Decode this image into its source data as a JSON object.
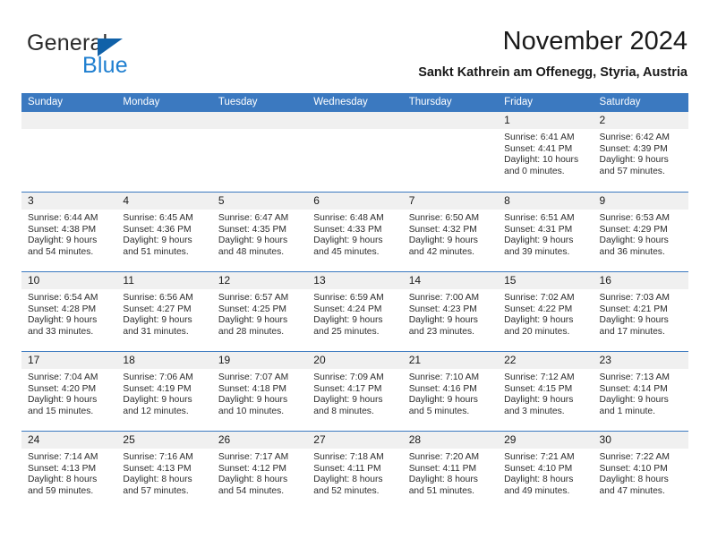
{
  "brand": {
    "name_top": "General",
    "name_bottom": "Blue"
  },
  "header": {
    "title": "November 2024",
    "subtitle": "Sankt Kathrein am Offenegg, Styria, Austria"
  },
  "colors": {
    "header_blue": "#3b79c0",
    "daynum_band": "#f0f0f0",
    "logo_blue": "#1f7fd0",
    "logo_triangle": "#1061a8",
    "text": "#1a1a1a"
  },
  "calendar": {
    "weekday_headers": [
      "Sunday",
      "Monday",
      "Tuesday",
      "Wednesday",
      "Thursday",
      "Friday",
      "Saturday"
    ],
    "weeks": [
      [
        {
          "day": "",
          "empty": true
        },
        {
          "day": "",
          "empty": true
        },
        {
          "day": "",
          "empty": true
        },
        {
          "day": "",
          "empty": true
        },
        {
          "day": "",
          "empty": true
        },
        {
          "day": "1",
          "sunrise": "Sunrise: 6:41 AM",
          "sunset": "Sunset: 4:41 PM",
          "daylight1": "Daylight: 10 hours",
          "daylight2": "and 0 minutes."
        },
        {
          "day": "2",
          "sunrise": "Sunrise: 6:42 AM",
          "sunset": "Sunset: 4:39 PM",
          "daylight1": "Daylight: 9 hours",
          "daylight2": "and 57 minutes."
        }
      ],
      [
        {
          "day": "3",
          "sunrise": "Sunrise: 6:44 AM",
          "sunset": "Sunset: 4:38 PM",
          "daylight1": "Daylight: 9 hours",
          "daylight2": "and 54 minutes."
        },
        {
          "day": "4",
          "sunrise": "Sunrise: 6:45 AM",
          "sunset": "Sunset: 4:36 PM",
          "daylight1": "Daylight: 9 hours",
          "daylight2": "and 51 minutes."
        },
        {
          "day": "5",
          "sunrise": "Sunrise: 6:47 AM",
          "sunset": "Sunset: 4:35 PM",
          "daylight1": "Daylight: 9 hours",
          "daylight2": "and 48 minutes."
        },
        {
          "day": "6",
          "sunrise": "Sunrise: 6:48 AM",
          "sunset": "Sunset: 4:33 PM",
          "daylight1": "Daylight: 9 hours",
          "daylight2": "and 45 minutes."
        },
        {
          "day": "7",
          "sunrise": "Sunrise: 6:50 AM",
          "sunset": "Sunset: 4:32 PM",
          "daylight1": "Daylight: 9 hours",
          "daylight2": "and 42 minutes."
        },
        {
          "day": "8",
          "sunrise": "Sunrise: 6:51 AM",
          "sunset": "Sunset: 4:31 PM",
          "daylight1": "Daylight: 9 hours",
          "daylight2": "and 39 minutes."
        },
        {
          "day": "9",
          "sunrise": "Sunrise: 6:53 AM",
          "sunset": "Sunset: 4:29 PM",
          "daylight1": "Daylight: 9 hours",
          "daylight2": "and 36 minutes."
        }
      ],
      [
        {
          "day": "10",
          "sunrise": "Sunrise: 6:54 AM",
          "sunset": "Sunset: 4:28 PM",
          "daylight1": "Daylight: 9 hours",
          "daylight2": "and 33 minutes."
        },
        {
          "day": "11",
          "sunrise": "Sunrise: 6:56 AM",
          "sunset": "Sunset: 4:27 PM",
          "daylight1": "Daylight: 9 hours",
          "daylight2": "and 31 minutes."
        },
        {
          "day": "12",
          "sunrise": "Sunrise: 6:57 AM",
          "sunset": "Sunset: 4:25 PM",
          "daylight1": "Daylight: 9 hours",
          "daylight2": "and 28 minutes."
        },
        {
          "day": "13",
          "sunrise": "Sunrise: 6:59 AM",
          "sunset": "Sunset: 4:24 PM",
          "daylight1": "Daylight: 9 hours",
          "daylight2": "and 25 minutes."
        },
        {
          "day": "14",
          "sunrise": "Sunrise: 7:00 AM",
          "sunset": "Sunset: 4:23 PM",
          "daylight1": "Daylight: 9 hours",
          "daylight2": "and 23 minutes."
        },
        {
          "day": "15",
          "sunrise": "Sunrise: 7:02 AM",
          "sunset": "Sunset: 4:22 PM",
          "daylight1": "Daylight: 9 hours",
          "daylight2": "and 20 minutes."
        },
        {
          "day": "16",
          "sunrise": "Sunrise: 7:03 AM",
          "sunset": "Sunset: 4:21 PM",
          "daylight1": "Daylight: 9 hours",
          "daylight2": "and 17 minutes."
        }
      ],
      [
        {
          "day": "17",
          "sunrise": "Sunrise: 7:04 AM",
          "sunset": "Sunset: 4:20 PM",
          "daylight1": "Daylight: 9 hours",
          "daylight2": "and 15 minutes."
        },
        {
          "day": "18",
          "sunrise": "Sunrise: 7:06 AM",
          "sunset": "Sunset: 4:19 PM",
          "daylight1": "Daylight: 9 hours",
          "daylight2": "and 12 minutes."
        },
        {
          "day": "19",
          "sunrise": "Sunrise: 7:07 AM",
          "sunset": "Sunset: 4:18 PM",
          "daylight1": "Daylight: 9 hours",
          "daylight2": "and 10 minutes."
        },
        {
          "day": "20",
          "sunrise": "Sunrise: 7:09 AM",
          "sunset": "Sunset: 4:17 PM",
          "daylight1": "Daylight: 9 hours",
          "daylight2": "and 8 minutes."
        },
        {
          "day": "21",
          "sunrise": "Sunrise: 7:10 AM",
          "sunset": "Sunset: 4:16 PM",
          "daylight1": "Daylight: 9 hours",
          "daylight2": "and 5 minutes."
        },
        {
          "day": "22",
          "sunrise": "Sunrise: 7:12 AM",
          "sunset": "Sunset: 4:15 PM",
          "daylight1": "Daylight: 9 hours",
          "daylight2": "and 3 minutes."
        },
        {
          "day": "23",
          "sunrise": "Sunrise: 7:13 AM",
          "sunset": "Sunset: 4:14 PM",
          "daylight1": "Daylight: 9 hours",
          "daylight2": "and 1 minute."
        }
      ],
      [
        {
          "day": "24",
          "sunrise": "Sunrise: 7:14 AM",
          "sunset": "Sunset: 4:13 PM",
          "daylight1": "Daylight: 8 hours",
          "daylight2": "and 59 minutes."
        },
        {
          "day": "25",
          "sunrise": "Sunrise: 7:16 AM",
          "sunset": "Sunset: 4:13 PM",
          "daylight1": "Daylight: 8 hours",
          "daylight2": "and 57 minutes."
        },
        {
          "day": "26",
          "sunrise": "Sunrise: 7:17 AM",
          "sunset": "Sunset: 4:12 PM",
          "daylight1": "Daylight: 8 hours",
          "daylight2": "and 54 minutes."
        },
        {
          "day": "27",
          "sunrise": "Sunrise: 7:18 AM",
          "sunset": "Sunset: 4:11 PM",
          "daylight1": "Daylight: 8 hours",
          "daylight2": "and 52 minutes."
        },
        {
          "day": "28",
          "sunrise": "Sunrise: 7:20 AM",
          "sunset": "Sunset: 4:11 PM",
          "daylight1": "Daylight: 8 hours",
          "daylight2": "and 51 minutes."
        },
        {
          "day": "29",
          "sunrise": "Sunrise: 7:21 AM",
          "sunset": "Sunset: 4:10 PM",
          "daylight1": "Daylight: 8 hours",
          "daylight2": "and 49 minutes."
        },
        {
          "day": "30",
          "sunrise": "Sunrise: 7:22 AM",
          "sunset": "Sunset: 4:10 PM",
          "daylight1": "Daylight: 8 hours",
          "daylight2": "and 47 minutes."
        }
      ]
    ]
  }
}
